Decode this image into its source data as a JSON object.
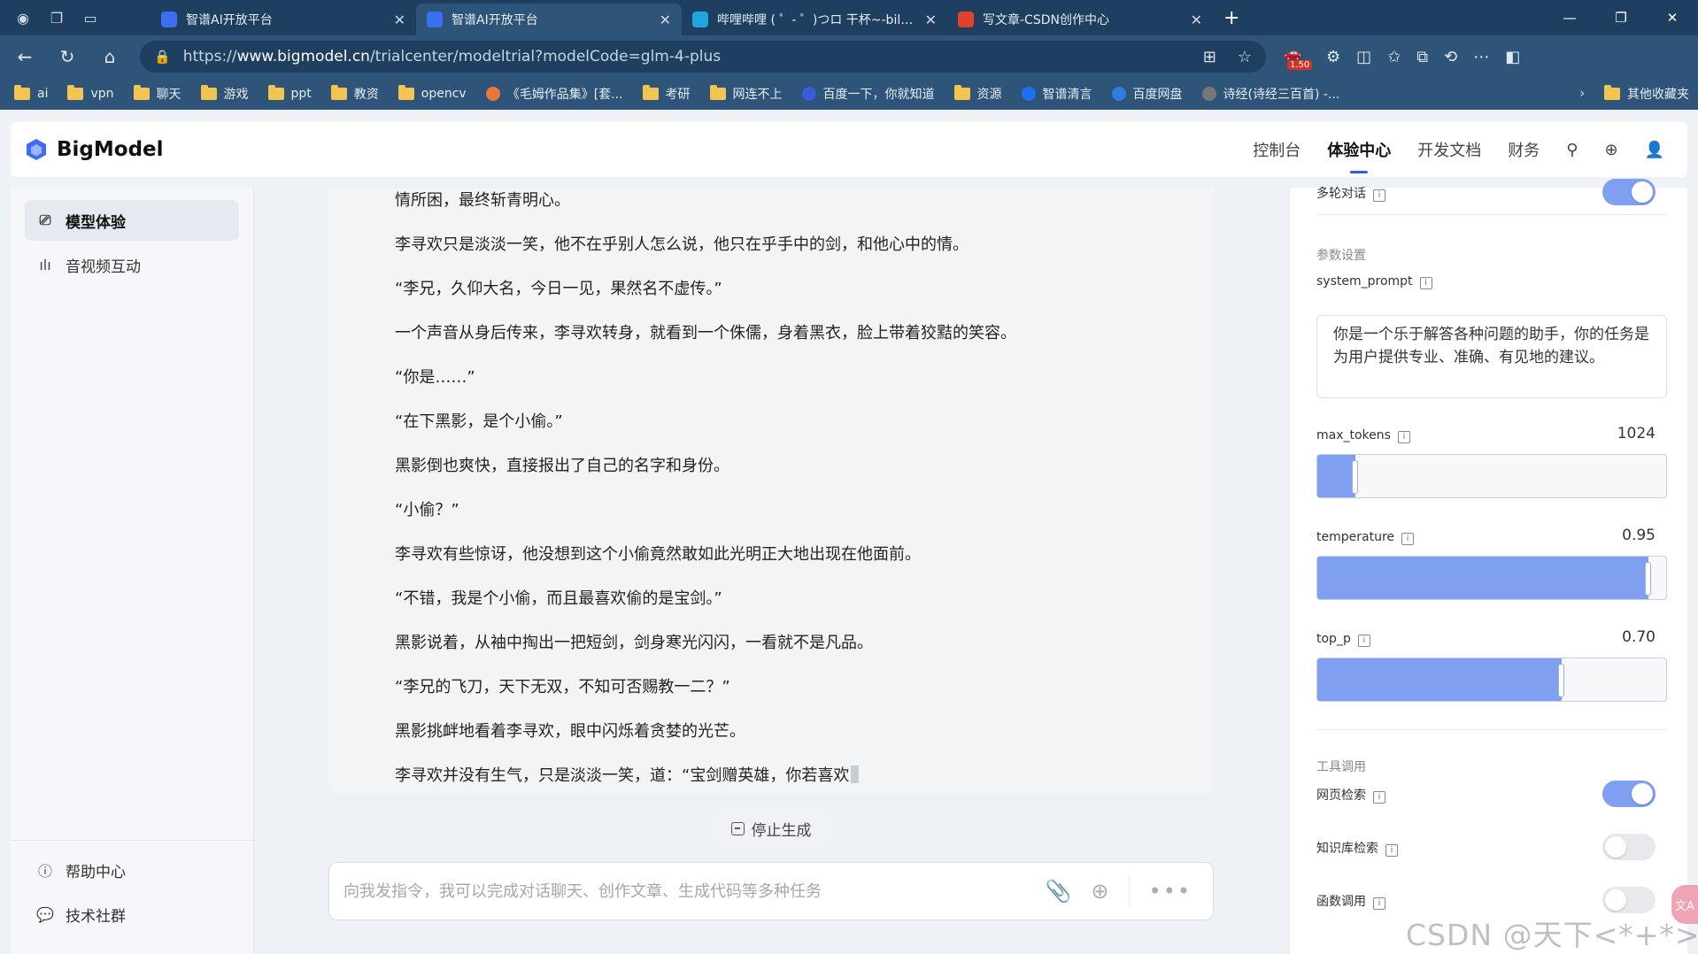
{
  "browser": {
    "tabs": [
      {
        "title": "智谱AI开放平台",
        "favicon_color": "#3a6ff0",
        "active": false
      },
      {
        "title": "智谱AI开放平台",
        "favicon_color": "#3a6ff0",
        "active": true
      },
      {
        "title": "哔哩哔哩 ( ゜- ゜)つロ 干杯~-bilibili",
        "favicon_color": "#1fa5e0",
        "active": false
      },
      {
        "title": "写文章-CSDN创作中心",
        "favicon_color": "#e0422f",
        "active": false
      }
    ],
    "url_prefix": "https://",
    "url_domain": "www.bigmodel.cn",
    "url_path": "/trialcenter/modeltrial?modelCode=glm-4-plus",
    "ext_badge": "1.50",
    "bookmarks": [
      {
        "label": "ai",
        "icon": "folder"
      },
      {
        "label": "vpn",
        "icon": "folder"
      },
      {
        "label": "聊天",
        "icon": "folder"
      },
      {
        "label": "游戏",
        "icon": "folder"
      },
      {
        "label": "ppt",
        "icon": "folder"
      },
      {
        "label": "教资",
        "icon": "folder"
      },
      {
        "label": "opencv",
        "icon": "folder"
      },
      {
        "label": "《毛姆作品集》[套...",
        "icon": "site"
      },
      {
        "label": "考研",
        "icon": "folder"
      },
      {
        "label": "网连不上",
        "icon": "folder"
      },
      {
        "label": "百度一下，你就知道",
        "icon": "site"
      },
      {
        "label": "资源",
        "icon": "folder"
      },
      {
        "label": "智谱清言",
        "icon": "site"
      },
      {
        "label": "百度网盘",
        "icon": "site"
      },
      {
        "label": "诗经(诗经三百首) -...",
        "icon": "site"
      }
    ],
    "bookmarks_other": "其他收藏夹"
  },
  "app": {
    "brand": "BigModel",
    "nav": [
      "控制台",
      "体验中心",
      "开发文档",
      "财务"
    ],
    "nav_active": "体验中心"
  },
  "sidebar": {
    "items": [
      {
        "label": "模型体验",
        "icon": "model-icon",
        "selected": true
      },
      {
        "label": "音视频互动",
        "icon": "audio-wave-icon",
        "selected": false
      }
    ],
    "bottom": [
      {
        "label": "帮助中心",
        "icon": "help-icon"
      },
      {
        "label": "技术社群",
        "icon": "chat-icon"
      }
    ]
  },
  "chat": {
    "paragraphs": [
      "情所困，最终斩青明心。",
      "李寻欢只是淡淡一笑，他不在乎别人怎么说，他只在乎手中的剑，和他心中的情。",
      "“李兄，久仰大名，今日一见，果然名不虚传。”",
      "一个声音从身后传来，李寻欢转身，就看到一个侏儒，身着黑衣，脸上带着狡黠的笑容。",
      "“你是……”",
      "“在下黑影，是个小偷。”",
      "黑影倒也爽快，直接报出了自己的名字和身份。",
      "“小偷？”",
      "李寻欢有些惊讶，他没想到这个小偷竟然敢如此光明正大地出现在他面前。",
      "“不错，我是个小偷，而且最喜欢偷的是宝剑。”",
      "黑影说着，从袖中掏出一把短剑，剑身寒光闪闪，一看就不是凡品。",
      "“李兄的飞刀，天下无双，不知可否赐教一二？”",
      "黑影挑衅地看着李寻欢，眼中闪烁着贪婪的光芒。",
      "李寻欢并没有生气，只是淡淡一笑，道：“宝剑赠英雄，你若喜欢"
    ],
    "stop_label": "停止生成",
    "input_placeholder": "向我发指令，我可以完成对话聊天、创作文章、生成代码等多种任务"
  },
  "params": {
    "multi_turn_label": "多轮对话",
    "multi_turn_on": true,
    "section_title": "参数设置",
    "system_prompt_label": "system_prompt",
    "system_prompt": "你是一个乐于解答各种问题的助手，你的任务是为用户提供专业、准确、有见地的建议。",
    "max_tokens_label": "max_tokens",
    "max_tokens_value": "1024",
    "max_tokens_fraction": 0.11,
    "temperature_label": "temperature",
    "temperature_value": "0.95",
    "temperature_fraction": 0.95,
    "top_p_label": "top_p",
    "top_p_value": "0.70",
    "top_p_fraction": 0.7,
    "tools_title": "工具调用",
    "web_search_label": "网页检索",
    "web_search_on": true,
    "kb_search_label": "知识库检索",
    "kb_search_on": false,
    "function_call_label": "函数调用",
    "function_call_on": false
  },
  "watermark": "CSDN @天下<*+*>"
}
